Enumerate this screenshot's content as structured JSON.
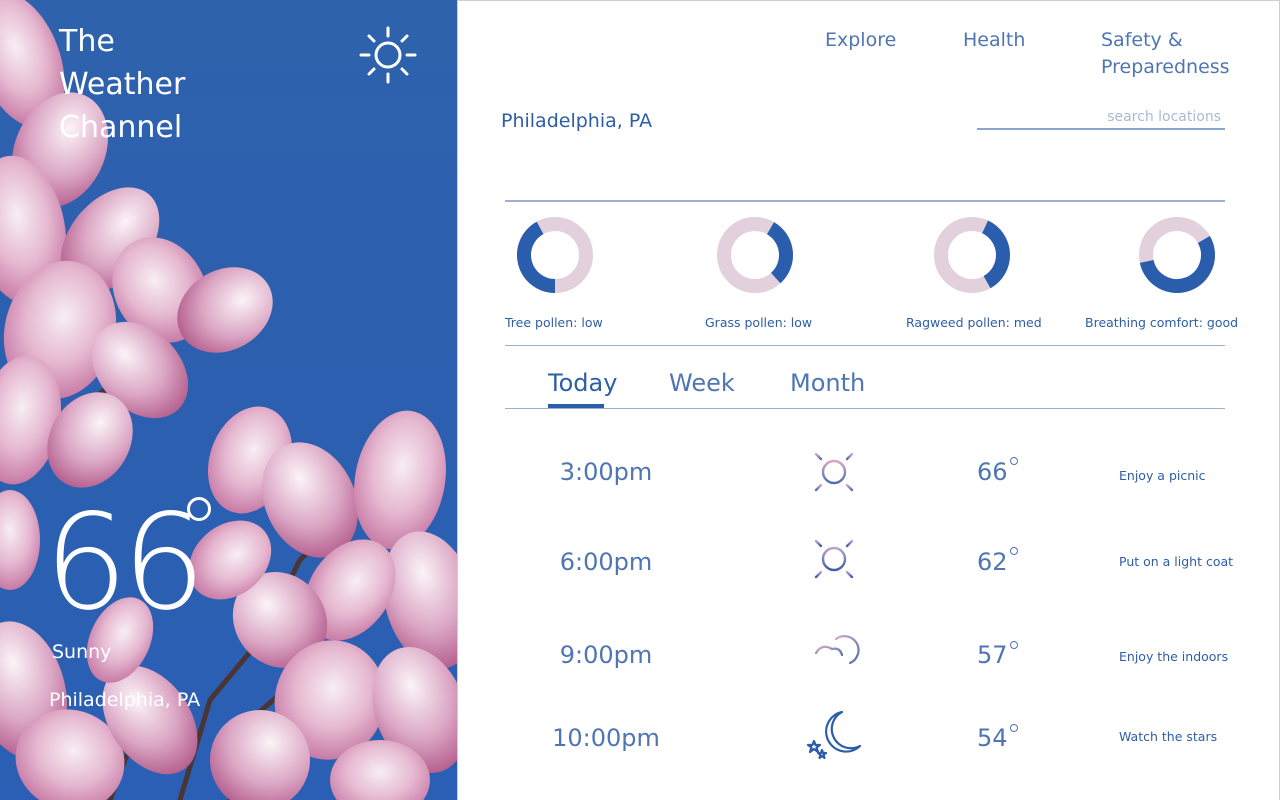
{
  "hero": {
    "brand_lines": [
      "The",
      "Weather",
      "Channel"
    ],
    "icon": "sun-icon",
    "temperature": "66",
    "condition": "Sunny",
    "location": "Philadelphia, PA"
  },
  "nav": {
    "items": [
      {
        "label": "Explore"
      },
      {
        "label": "Health"
      },
      {
        "label": "Safety & Preparedness"
      }
    ]
  },
  "location_title": "Philadelphia, PA",
  "search": {
    "placeholder": "search locations",
    "value": ""
  },
  "pollen": [
    {
      "label": "Tree pollen: low",
      "level": 0.42
    },
    {
      "label": "Grass pollen: low",
      "level": 0.3
    },
    {
      "label": "Ragweed pollen: med",
      "level": 0.35
    },
    {
      "label": "Breathing comfort: good",
      "level": 0.55
    }
  ],
  "tabs": [
    {
      "label": "Today",
      "active": true
    },
    {
      "label": "Week",
      "active": false
    },
    {
      "label": "Month",
      "active": false
    }
  ],
  "forecast": [
    {
      "time": "3:00pm",
      "icon": "sun-icon",
      "temp": "66",
      "tip": "Enjoy a picnic"
    },
    {
      "time": "6:00pm",
      "icon": "sun-icon",
      "temp": "62",
      "tip": "Put on a light coat"
    },
    {
      "time": "9:00pm",
      "icon": "windy-cloud-moon-icon",
      "temp": "57",
      "tip": "Enjoy the indoors"
    },
    {
      "time": "10:00pm",
      "icon": "moon-stars-icon",
      "temp": "54",
      "tip": "Watch the stars"
    }
  ],
  "colors": {
    "accent": "#2a5dab",
    "text_blue": "#4f76b3",
    "ring_track": "#e2d0dd",
    "hero_sky": "#2f62ad"
  }
}
